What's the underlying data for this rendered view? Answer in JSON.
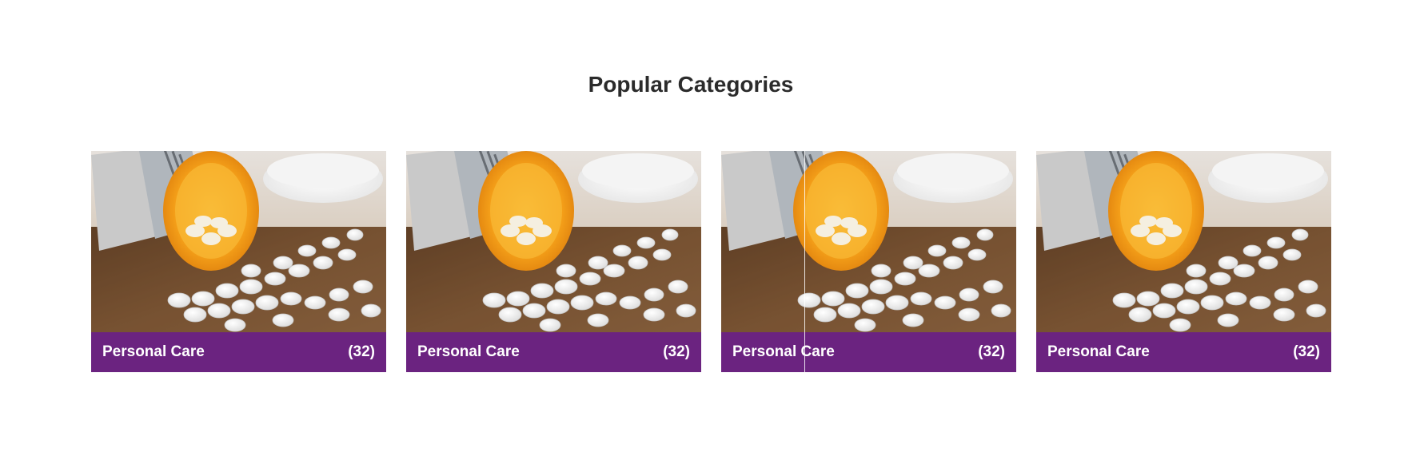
{
  "section": {
    "title": "Popular Categories"
  },
  "categories": [
    {
      "name": "Personal Care",
      "count": "(32)",
      "image": "pill-bottle-photo"
    },
    {
      "name": "Personal Care",
      "count": "(32)",
      "image": "pill-bottle-photo"
    },
    {
      "name": "Personal Care",
      "count": "(32)",
      "image": "pill-bottle-photo"
    },
    {
      "name": "Personal Care",
      "count": "(32)",
      "image": "pill-bottle-photo"
    }
  ],
  "colors": {
    "footer_bg": "#6b2380",
    "footer_text": "#ffffff",
    "title_text": "#2b2b2b"
  }
}
